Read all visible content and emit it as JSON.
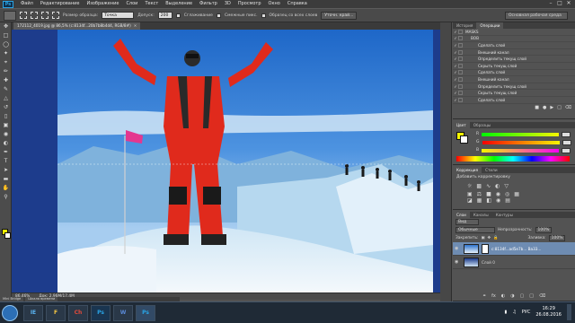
{
  "menubar": {
    "logo": "Ps",
    "items": [
      "Файл",
      "Редактирование",
      "Изображение",
      "Слои",
      "Текст",
      "Выделение",
      "Фильтр",
      "3D",
      "Просмотр",
      "Окно",
      "Справка"
    ]
  },
  "options": {
    "style_label": "Размер образца:",
    "style_value": "Точка",
    "tolerance_label": "Допуск:",
    "tolerance_value": "200",
    "antialias_label": "Сглаживание",
    "contiguous_label": "Смежные пикс.",
    "sample_all_label": "Образец со всех слоев",
    "refine_button": "Уточн. край...",
    "workspace": "Основная рабочая среда"
  },
  "document": {
    "tab_title": "172112_4019.jpg @ 86,5% (c:8134f...20b7b8b4d4, RGB/8#)",
    "zoom": "86,46%",
    "doc_info": "Док: 2,96M/17,4M"
  },
  "actions_panel": {
    "tabs": [
      "История",
      "Операции"
    ],
    "group": "MASKS",
    "subgroup": "BOB",
    "rows": [
      "Сделать слой",
      "Внешний канал",
      "Определить текущ слой",
      "Скрыть текущ слой",
      "Сделать слой",
      "Внешний канал",
      "Определить текущ слой",
      "Скрыть текущ слой",
      "Сделать слой"
    ]
  },
  "color_panel": {
    "tabs": [
      "Цвет",
      "Образцы"
    ],
    "channels": [
      "R",
      "G",
      "B"
    ]
  },
  "adjustments_panel": {
    "tabs": [
      "Коррекция",
      "Стили"
    ],
    "title": "Добавить корректировку"
  },
  "layers_panel": {
    "tabs": [
      "Слои",
      "Каналы",
      "Контуры"
    ],
    "kind_filter": "Вид",
    "blend_mode": "Обычные",
    "opacity_label": "Непрозрачность:",
    "opacity_value": "100%",
    "lock_label": "Закрепить:",
    "fill_label": "Заливка:",
    "fill_value": "100%",
    "layers": [
      {
        "name": "c:8134f...ad5e7b... Ba33...",
        "selected": true
      },
      {
        "name": "Слой 0",
        "selected": false
      }
    ]
  },
  "bottom_tabs": [
    "Mini Bridge",
    "Шкала времени"
  ],
  "taskbar": {
    "apps": [
      "IE",
      "F",
      "Ch",
      "Ps",
      "W",
      "Ps"
    ],
    "lang": "РУС",
    "time": "16:29",
    "date": "26.08.2016"
  },
  "colors": {
    "accent_blue": "#2aa3e4",
    "foreground_swatch": "#f6f600",
    "background_swatch": "#ffffff",
    "jacket_red": "#e02a1c"
  }
}
